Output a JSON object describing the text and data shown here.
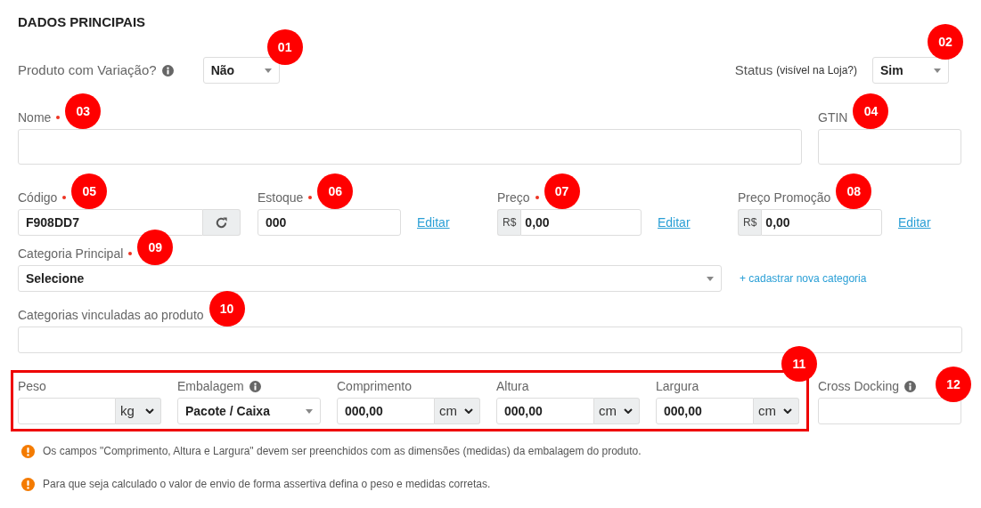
{
  "title": "DADOS PRINCIPAIS",
  "variation": {
    "label": "Produto com Variação?",
    "info": true,
    "value": "Não",
    "marker": "01"
  },
  "status": {
    "label": "Status",
    "hint": "(visível na Loja?)",
    "value": "Sim",
    "marker": "02"
  },
  "name_row": [
    {
      "label": "Nome",
      "required": true,
      "marker": "03"
    },
    {
      "label": "GTIN",
      "required": false,
      "marker": "04"
    }
  ],
  "price_row": [
    {
      "kind": "code",
      "label": "Código",
      "required": true,
      "marker": "05",
      "value": "F908DD7"
    },
    {
      "kind": "link",
      "label": "Estoque",
      "required": true,
      "marker": "06",
      "value": "000",
      "link": "Editar"
    },
    {
      "kind": "currency",
      "label": "Preço",
      "required": true,
      "marker": "07",
      "prefix": "R$",
      "value": "0,00",
      "link": "Editar"
    },
    {
      "kind": "currency",
      "label": "Preço Promoção",
      "required": false,
      "marker": "08",
      "prefix": "R$",
      "value": "0,00",
      "link": "Editar"
    }
  ],
  "main_category": {
    "label": "Categoria Principal",
    "required": true,
    "marker": "09",
    "value": "Selecione",
    "link": "+ cadastrar nova categoria"
  },
  "linked_categories": {
    "label": "Categorias vinculadas ao produto",
    "required": false,
    "marker": "10"
  },
  "dimensions": {
    "marker": "11",
    "fields": [
      {
        "kind": "unit",
        "label": "Peso",
        "info": false,
        "unit": "kg"
      },
      {
        "kind": "select",
        "label": "Embalagem",
        "info": true,
        "value": "Pacote / Caixa"
      },
      {
        "kind": "unit",
        "label": "Comprimento",
        "info": false,
        "value": "000,00",
        "unit": "cm"
      },
      {
        "kind": "unit",
        "label": "Altura",
        "info": false,
        "value": "000,00",
        "unit": "cm"
      },
      {
        "kind": "unit",
        "label": "Largura",
        "info": false,
        "value": "000,00",
        "unit": "cm"
      }
    ]
  },
  "cross_docking": {
    "label": "Cross Docking",
    "info": true,
    "marker": "12"
  },
  "notes": [
    "Os campos \"Comprimento, Altura e Largura\" devem ser preenchidos com as dimensões (medidas) da embalagem do produto.",
    "Para que seja calculado o valor de envio de forma assertiva defina o peso e medidas corretas."
  ]
}
